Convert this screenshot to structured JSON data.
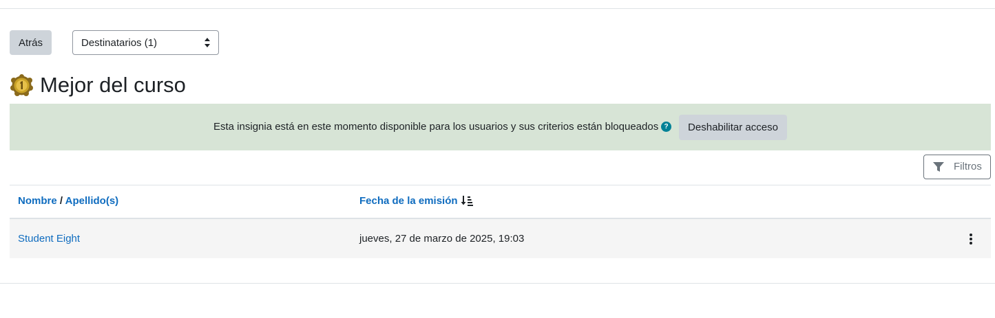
{
  "nav": {
    "back_label": "Atrás",
    "recipients_select": {
      "selected": "Destinatarios (1)"
    }
  },
  "badge": {
    "title": "Mejor del curso",
    "icon": "medal-badge-icon"
  },
  "alert": {
    "message": "Esta insignia está en este momento disponible para los usuarios y sus criterios están bloqueados",
    "help_icon": "?",
    "disable_label": "Deshabilitar acceso"
  },
  "filters": {
    "label": "Filtros",
    "icon": "funnel-icon"
  },
  "table": {
    "headers": {
      "first_name": "Nombre",
      "separator": "/",
      "last_name": "Apellido(s)",
      "date": "Fecha de la emisión",
      "sort_icon": "sort-descending-icon"
    },
    "rows": [
      {
        "name": "Student Eight",
        "date": "jueves, 27 de marzo de 2025, 19:03",
        "actions_icon": "kebab-menu-icon"
      }
    ]
  },
  "colors": {
    "link": "#0f6cbf",
    "alert_bg": "#d7e4d6",
    "button_bg": "#ced4da",
    "help_icon": "#008196",
    "row_bg": "#f5f5f5"
  }
}
